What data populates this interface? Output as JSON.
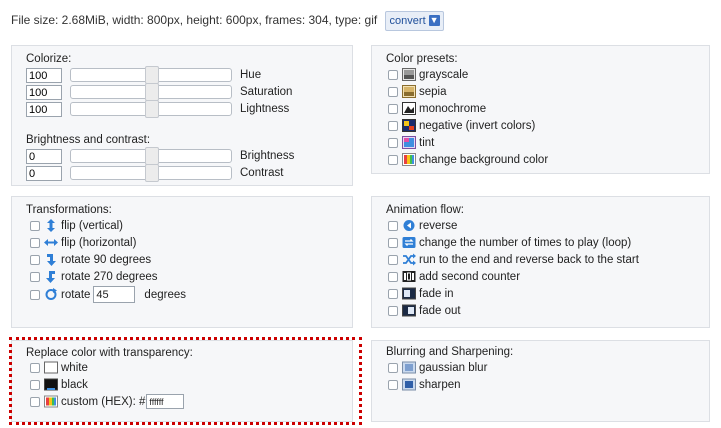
{
  "info": {
    "text": "File size: 2.68MiB, width: 800px, height: 600px, frames: 304, type: gif",
    "convert_label": "convert"
  },
  "colorize": {
    "title": "Colorize:",
    "hue": {
      "value": "100",
      "label": "Hue",
      "slider_fraction": 0.5
    },
    "saturation": {
      "value": "100",
      "label": "Saturation",
      "slider_fraction": 0.5
    },
    "lightness": {
      "value": "100",
      "label": "Lightness",
      "slider_fraction": 0.5
    }
  },
  "brightness_contrast": {
    "title": "Brightness and contrast:",
    "brightness": {
      "value": "0",
      "label": "Brightness",
      "slider_fraction": 0.5
    },
    "contrast": {
      "value": "0",
      "label": "Contrast",
      "slider_fraction": 0.5
    }
  },
  "presets": {
    "title": "Color presets:",
    "items": [
      {
        "label": "grayscale",
        "icon": "grayscale-icon"
      },
      {
        "label": "sepia",
        "icon": "sepia-icon"
      },
      {
        "label": "monochrome",
        "icon": "monochrome-icon"
      },
      {
        "label": "negative (invert colors)",
        "icon": "negative-icon"
      },
      {
        "label": "tint",
        "icon": "tint-icon"
      },
      {
        "label": "change background color",
        "icon": "background-color-icon"
      }
    ]
  },
  "transformations": {
    "title": "Transformations:",
    "flip_vertical": "flip (vertical)",
    "flip_horizontal": "flip (horizontal)",
    "rotate_90": "rotate 90 degrees",
    "rotate_270": "rotate 270 degrees",
    "rotate": "rotate",
    "rotate_value": "45",
    "degrees": "degrees"
  },
  "animation": {
    "title": "Animation flow:",
    "items": [
      {
        "label": "reverse",
        "icon": "reverse-icon"
      },
      {
        "label": "change the number of times to play (loop)",
        "icon": "loop-icon"
      },
      {
        "label": "run to the end and reverse back to the start",
        "icon": "shuffle-icon"
      },
      {
        "label": "add second counter",
        "icon": "counter-icon"
      },
      {
        "label": "fade in",
        "icon": "fade-in-icon"
      },
      {
        "label": "fade out",
        "icon": "fade-out-icon"
      }
    ]
  },
  "replace": {
    "title": "Replace color with transparency:",
    "white": "white",
    "black": "black",
    "custom": "custom (HEX): #",
    "custom_value": "ffffff"
  },
  "blur": {
    "title": "Blurring and Sharpening:",
    "gaussian": "gaussian blur",
    "sharpen": "sharpen"
  },
  "colors": {
    "panel_bg": "#f6f7f9",
    "accent": "#1f6fd1",
    "highlight_border": "#cc0000"
  }
}
